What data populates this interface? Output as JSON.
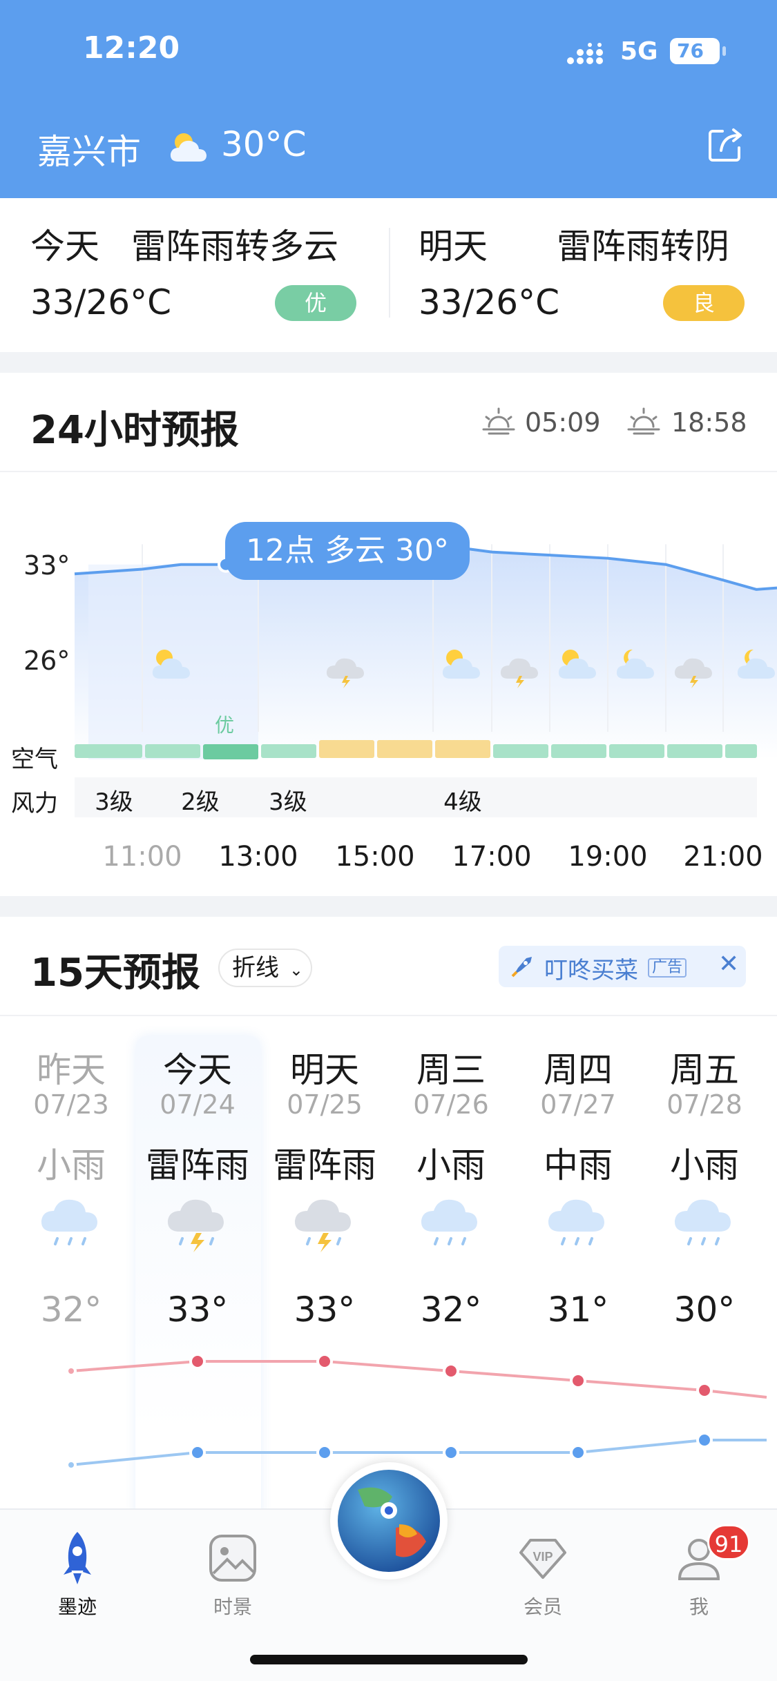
{
  "status_bar": {
    "time": "12:20",
    "network": "5G",
    "battery": "76"
  },
  "header": {
    "city": "嘉兴市",
    "current_temp": "30°C"
  },
  "today_summary": {
    "today": {
      "label": "今天",
      "condition": "雷阵雨转多云",
      "temp": "33/26°C",
      "aqi": "优",
      "aqi_color": "#79cda4"
    },
    "tomorrow": {
      "label": "明天",
      "condition": "雷阵雨转阴",
      "temp": "33/26°C",
      "aqi": "良",
      "aqi_color": "#f5c23d"
    }
  },
  "hourly": {
    "title": "24小时预报",
    "sunrise": "05:09",
    "sunset": "18:58",
    "tooltip": "12点 多云 30°",
    "y_labels": [
      "33°",
      "26°"
    ],
    "air_label": "空气",
    "wind_label": "风力",
    "air_current": "优",
    "wind": [
      {
        "text": "3级",
        "cx": 165
      },
      {
        "text": "2级",
        "cx": 290
      },
      {
        "text": "3级",
        "cx": 417
      },
      {
        "text": "4级",
        "cx": 670
      }
    ],
    "ticks": [
      "11:00",
      "13:00",
      "15:00",
      "17:00",
      "19:00",
      "21:00"
    ]
  },
  "chart_data": {
    "type": "line",
    "title": "24小时预报",
    "x": [
      "10:30",
      "11:00",
      "11:30",
      "12:00",
      "12:30",
      "13:00",
      "14:00",
      "15:00",
      "16:00",
      "17:00",
      "18:00",
      "19:00",
      "20:00",
      "21:00",
      "21:30"
    ],
    "series": [
      {
        "values": [
          29.4,
          29.7,
          30.0,
          30.0,
          30.5,
          31.2,
          31.3,
          31.3,
          30.8,
          30.6,
          30.4,
          30.0,
          29.0,
          28.4,
          28.5
        ]
      }
    ],
    "ylim": [
      26,
      33
    ],
    "air_quality": [
      "优",
      "优",
      "优",
      "优",
      "良",
      "良",
      "良",
      "优",
      "优",
      "优",
      "优",
      "优"
    ],
    "daily_high": {
      "categories": [
        "07/23",
        "07/24",
        "07/25",
        "07/26",
        "07/27",
        "07/28"
      ],
      "values": [
        32,
        33,
        33,
        32,
        31,
        30
      ]
    },
    "daily_low": {
      "categories": [
        "07/23",
        "07/24",
        "07/25",
        "07/26",
        "07/27",
        "07/28"
      ],
      "values": [
        25,
        26,
        26,
        26,
        26,
        27
      ]
    }
  },
  "daily": {
    "title": "15天预报",
    "view_mode": "折线",
    "ad": {
      "text": "叮咚买菜",
      "tag": "广告"
    },
    "days": [
      {
        "name": "昨天",
        "date": "07/23",
        "cond": "小雨",
        "hi": "32°",
        "icon": "rain"
      },
      {
        "name": "今天",
        "date": "07/24",
        "cond": "雷阵雨",
        "hi": "33°",
        "icon": "thunder"
      },
      {
        "name": "明天",
        "date": "07/25",
        "cond": "雷阵雨",
        "hi": "33°",
        "icon": "thunder"
      },
      {
        "name": "周三",
        "date": "07/26",
        "cond": "小雨",
        "hi": "32°",
        "icon": "rain"
      },
      {
        "name": "周四",
        "date": "07/27",
        "cond": "中雨",
        "hi": "31°",
        "icon": "rain"
      },
      {
        "name": "周五",
        "date": "07/28",
        "cond": "小雨",
        "hi": "30°",
        "icon": "rain"
      }
    ]
  },
  "tabbar": {
    "items": [
      {
        "label": "墨迹"
      },
      {
        "label": "时景"
      },
      {
        "label": "会员"
      },
      {
        "label": "我"
      }
    ],
    "vip_text": "VIP",
    "badge": "91"
  }
}
